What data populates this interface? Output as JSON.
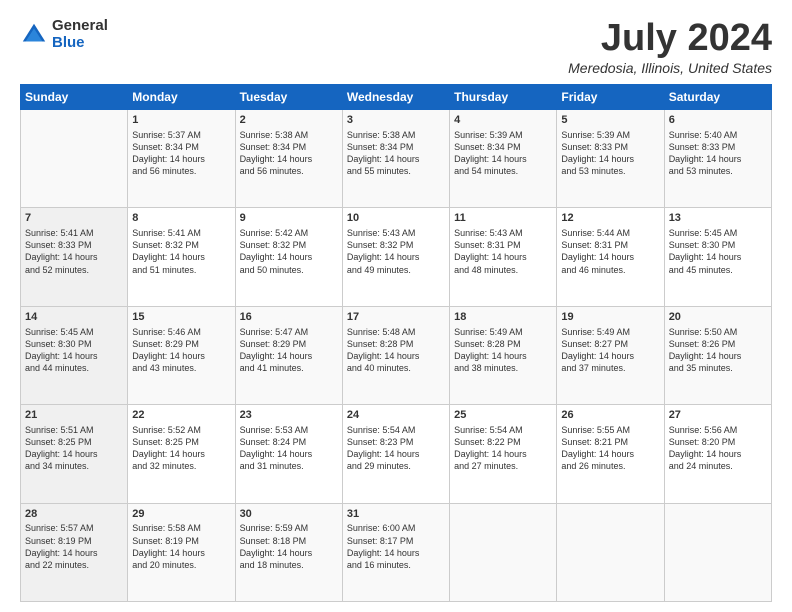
{
  "logo": {
    "general": "General",
    "blue": "Blue"
  },
  "header": {
    "title": "July 2024",
    "subtitle": "Meredosia, Illinois, United States"
  },
  "days_of_week": [
    "Sunday",
    "Monday",
    "Tuesday",
    "Wednesday",
    "Thursday",
    "Friday",
    "Saturday"
  ],
  "weeks": [
    [
      {
        "day": "",
        "info": ""
      },
      {
        "day": "1",
        "info": "Sunrise: 5:37 AM\nSunset: 8:34 PM\nDaylight: 14 hours\nand 56 minutes."
      },
      {
        "day": "2",
        "info": "Sunrise: 5:38 AM\nSunset: 8:34 PM\nDaylight: 14 hours\nand 56 minutes."
      },
      {
        "day": "3",
        "info": "Sunrise: 5:38 AM\nSunset: 8:34 PM\nDaylight: 14 hours\nand 55 minutes."
      },
      {
        "day": "4",
        "info": "Sunrise: 5:39 AM\nSunset: 8:34 PM\nDaylight: 14 hours\nand 54 minutes."
      },
      {
        "day": "5",
        "info": "Sunrise: 5:39 AM\nSunset: 8:33 PM\nDaylight: 14 hours\nand 53 minutes."
      },
      {
        "day": "6",
        "info": "Sunrise: 5:40 AM\nSunset: 8:33 PM\nDaylight: 14 hours\nand 53 minutes."
      }
    ],
    [
      {
        "day": "7",
        "info": "Sunrise: 5:41 AM\nSunset: 8:33 PM\nDaylight: 14 hours\nand 52 minutes."
      },
      {
        "day": "8",
        "info": "Sunrise: 5:41 AM\nSunset: 8:32 PM\nDaylight: 14 hours\nand 51 minutes."
      },
      {
        "day": "9",
        "info": "Sunrise: 5:42 AM\nSunset: 8:32 PM\nDaylight: 14 hours\nand 50 minutes."
      },
      {
        "day": "10",
        "info": "Sunrise: 5:43 AM\nSunset: 8:32 PM\nDaylight: 14 hours\nand 49 minutes."
      },
      {
        "day": "11",
        "info": "Sunrise: 5:43 AM\nSunset: 8:31 PM\nDaylight: 14 hours\nand 48 minutes."
      },
      {
        "day": "12",
        "info": "Sunrise: 5:44 AM\nSunset: 8:31 PM\nDaylight: 14 hours\nand 46 minutes."
      },
      {
        "day": "13",
        "info": "Sunrise: 5:45 AM\nSunset: 8:30 PM\nDaylight: 14 hours\nand 45 minutes."
      }
    ],
    [
      {
        "day": "14",
        "info": "Sunrise: 5:45 AM\nSunset: 8:30 PM\nDaylight: 14 hours\nand 44 minutes."
      },
      {
        "day": "15",
        "info": "Sunrise: 5:46 AM\nSunset: 8:29 PM\nDaylight: 14 hours\nand 43 minutes."
      },
      {
        "day": "16",
        "info": "Sunrise: 5:47 AM\nSunset: 8:29 PM\nDaylight: 14 hours\nand 41 minutes."
      },
      {
        "day": "17",
        "info": "Sunrise: 5:48 AM\nSunset: 8:28 PM\nDaylight: 14 hours\nand 40 minutes."
      },
      {
        "day": "18",
        "info": "Sunrise: 5:49 AM\nSunset: 8:28 PM\nDaylight: 14 hours\nand 38 minutes."
      },
      {
        "day": "19",
        "info": "Sunrise: 5:49 AM\nSunset: 8:27 PM\nDaylight: 14 hours\nand 37 minutes."
      },
      {
        "day": "20",
        "info": "Sunrise: 5:50 AM\nSunset: 8:26 PM\nDaylight: 14 hours\nand 35 minutes."
      }
    ],
    [
      {
        "day": "21",
        "info": "Sunrise: 5:51 AM\nSunset: 8:25 PM\nDaylight: 14 hours\nand 34 minutes."
      },
      {
        "day": "22",
        "info": "Sunrise: 5:52 AM\nSunset: 8:25 PM\nDaylight: 14 hours\nand 32 minutes."
      },
      {
        "day": "23",
        "info": "Sunrise: 5:53 AM\nSunset: 8:24 PM\nDaylight: 14 hours\nand 31 minutes."
      },
      {
        "day": "24",
        "info": "Sunrise: 5:54 AM\nSunset: 8:23 PM\nDaylight: 14 hours\nand 29 minutes."
      },
      {
        "day": "25",
        "info": "Sunrise: 5:54 AM\nSunset: 8:22 PM\nDaylight: 14 hours\nand 27 minutes."
      },
      {
        "day": "26",
        "info": "Sunrise: 5:55 AM\nSunset: 8:21 PM\nDaylight: 14 hours\nand 26 minutes."
      },
      {
        "day": "27",
        "info": "Sunrise: 5:56 AM\nSunset: 8:20 PM\nDaylight: 14 hours\nand 24 minutes."
      }
    ],
    [
      {
        "day": "28",
        "info": "Sunrise: 5:57 AM\nSunset: 8:19 PM\nDaylight: 14 hours\nand 22 minutes."
      },
      {
        "day": "29",
        "info": "Sunrise: 5:58 AM\nSunset: 8:19 PM\nDaylight: 14 hours\nand 20 minutes."
      },
      {
        "day": "30",
        "info": "Sunrise: 5:59 AM\nSunset: 8:18 PM\nDaylight: 14 hours\nand 18 minutes."
      },
      {
        "day": "31",
        "info": "Sunrise: 6:00 AM\nSunset: 8:17 PM\nDaylight: 14 hours\nand 16 minutes."
      },
      {
        "day": "",
        "info": ""
      },
      {
        "day": "",
        "info": ""
      },
      {
        "day": "",
        "info": ""
      }
    ]
  ]
}
